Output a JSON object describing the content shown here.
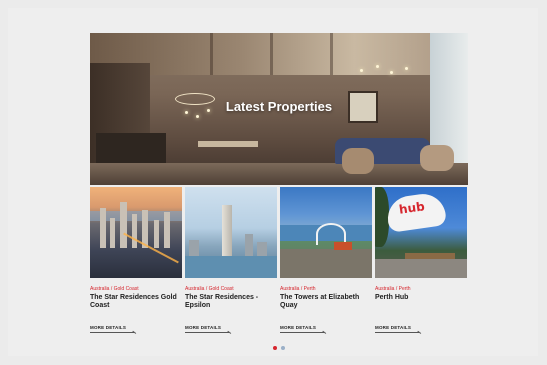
{
  "hero": {
    "title": "Latest Properties"
  },
  "properties": [
    {
      "location": "Australia / Gold Coast",
      "name": "The Star Residences Gold Coast",
      "cta": "MORE DETAILS"
    },
    {
      "location": "Australia / Gold Coast",
      "name": "The Star Residences - Epsilon",
      "cta": "MORE DETAILS"
    },
    {
      "location": "Australia / Perth",
      "name": "The Towers at Elizabeth Quay",
      "cta": "MORE DETAILS"
    },
    {
      "location": "Australia / Perth",
      "name": "Perth Hub",
      "cta": "MORE DETAILS"
    }
  ],
  "photo_sign_text": "hub",
  "pagination": {
    "count": 2,
    "active_index": 0
  },
  "colors": {
    "accent": "#d6262e",
    "inactive_dot": "#9bb0c8",
    "background": "#ebebeb"
  }
}
